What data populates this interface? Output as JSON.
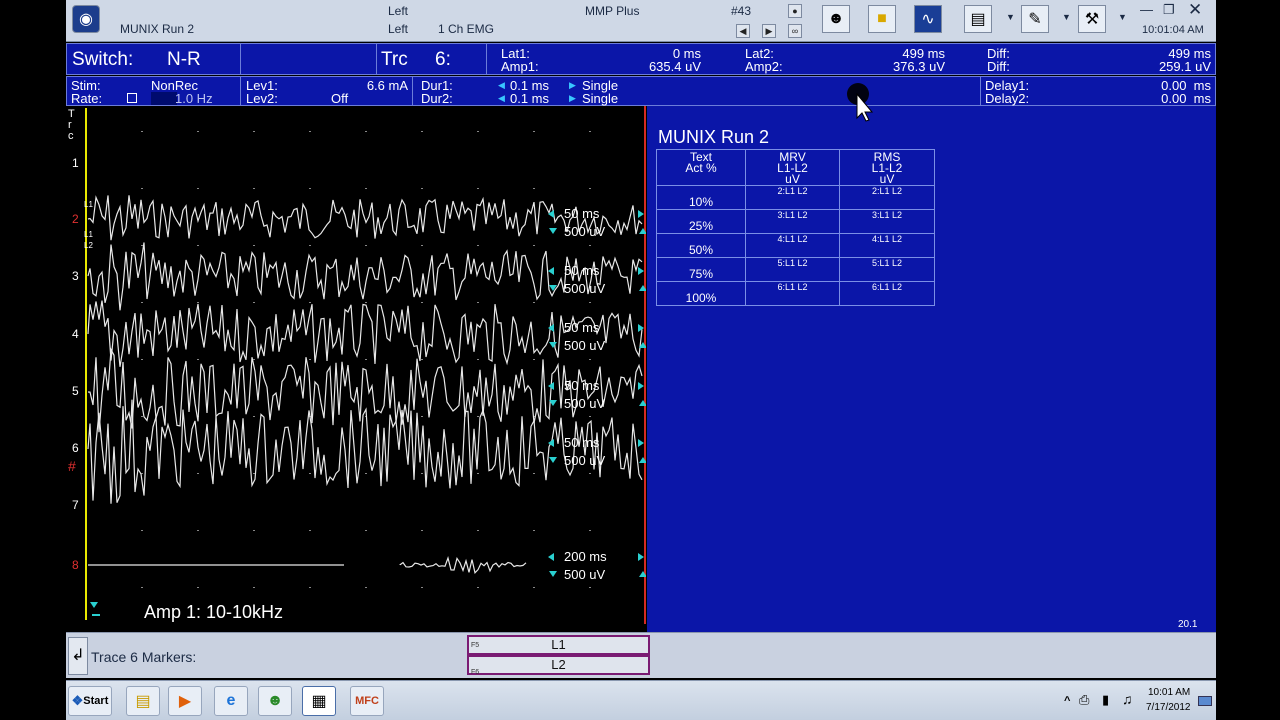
{
  "titlebar": {
    "window_title": "MUNIX Run 2",
    "side_top": "Left",
    "side_bottom": "Left",
    "channel": "1 Ch EMG",
    "study": "MMP Plus",
    "trace_number": "#43",
    "clock": "10:01:04 AM",
    "icons": [
      "patient-icon",
      "folder-icon",
      "waveform-icon",
      "report-icon",
      "edit-icon",
      "tools-icon"
    ]
  },
  "status1": {
    "switch_label": "Switch:",
    "switch_value": "N-R",
    "trc_label": "Trc",
    "trc_value": "6:",
    "lat1_label": "Lat1:",
    "lat1_value": "0 ms",
    "amp1_label": "Amp1:",
    "amp1_value": "635.4 uV",
    "lat2_label": "Lat2:",
    "lat2_value": "499 ms",
    "amp2_label": "Amp2:",
    "amp2_value": "376.3 uV",
    "diff_label": "Diff:",
    "diff_lat": "499 ms",
    "diff_amp": "259.1 uV"
  },
  "status2": {
    "stim_label": "Stim:",
    "stim_value": "NonRec",
    "rate_label": "Rate:",
    "rate_value": "1.0 Hz",
    "lev1_label": "Lev1:",
    "lev1_value": "6.6 mA",
    "lev2_label": "Lev2:",
    "lev2_value": "Off",
    "dur1_label": "Dur1:",
    "dur1_value": "0.1 ms",
    "dur2_label": "Dur2:",
    "dur2_value": "0.1 ms",
    "mode1": "Single",
    "mode2": "Single",
    "delay1_label": "Delay1:",
    "delay1_value": "0.00  ms",
    "delay2_label": "Delay2:",
    "delay2_value": "0.00  ms"
  },
  "plot": {
    "trc_vertical": "T r c",
    "amp_label": "Amp 1: 10-10kHz",
    "trace_numbers": [
      "1",
      "2",
      "3",
      "4",
      "5",
      "6",
      "7",
      "8"
    ],
    "hash": "#",
    "sweep": "50 ms",
    "sensitivity": "500 uV",
    "sweep_bottom": "200 ms",
    "sensitivity_bottom": "500 uV",
    "marker_l1": "L1",
    "marker_l2": "L2"
  },
  "munix": {
    "title": "MUNIX Run 2",
    "headers": [
      [
        "Text",
        "Act %"
      ],
      [
        "MRV",
        "L1-L2",
        "uV"
      ],
      [
        "RMS",
        "L1-L2",
        "uV"
      ]
    ],
    "rows": [
      {
        "act": "10%",
        "mrv": "2:L1 L2",
        "rms": "2:L1 L2"
      },
      {
        "act": "25%",
        "mrv": "3:L1 L2",
        "rms": "3:L1 L2"
      },
      {
        "act": "50%",
        "mrv": "4:L1 L2",
        "rms": "4:L1 L2"
      },
      {
        "act": "75%",
        "mrv": "5:L1 L2",
        "rms": "5:L1 L2"
      },
      {
        "act": "100%",
        "mrv": "6:L1 L2",
        "rms": "6:L1 L2"
      }
    ],
    "version": "20.1"
  },
  "markers": {
    "label": "Trace 6 Markers:",
    "f5": "F5",
    "f6": "F6",
    "l1": "L1",
    "l2": "L2"
  },
  "taskbar": {
    "start": "Start",
    "time": "10:01 AM",
    "date": "7/17/2012",
    "tray": "^"
  }
}
